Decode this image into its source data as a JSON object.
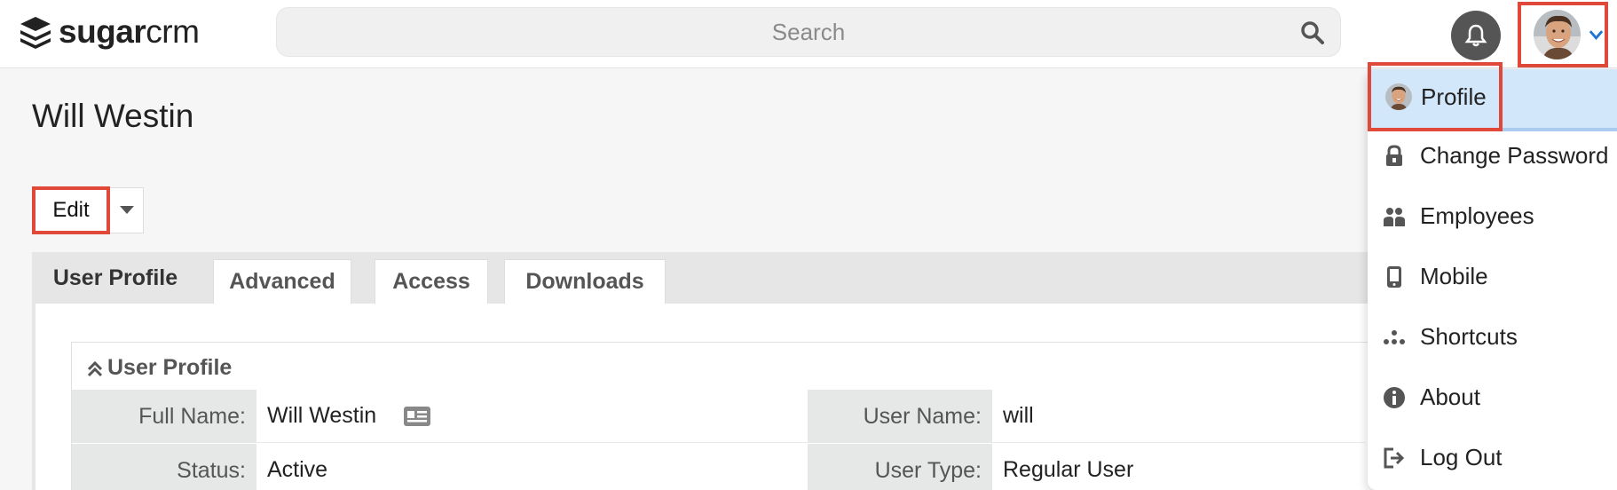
{
  "header": {
    "logo": {
      "bold": "sugar",
      "light": "crm"
    },
    "search": {
      "placeholder": "Search"
    },
    "icons": {
      "search": "search-icon",
      "notifications": "bell-icon",
      "user_menu": "chevron-down-icon"
    }
  },
  "record": {
    "title": "Will Westin",
    "edit_label": "Edit"
  },
  "tabs": [
    {
      "label": "User Profile",
      "active": true
    },
    {
      "label": "Advanced",
      "active": false
    },
    {
      "label": "Access",
      "active": false
    },
    {
      "label": "Downloads",
      "active": false
    }
  ],
  "section": {
    "title": "User Profile",
    "fields": [
      {
        "label": "Full Name:",
        "value": "Will Westin"
      },
      {
        "label": "User Name:",
        "value": "will"
      },
      {
        "label": "Status:",
        "value": "Active"
      },
      {
        "label": "User Type:",
        "value": "Regular User"
      }
    ]
  },
  "user_menu": {
    "items": [
      {
        "label": "Profile",
        "icon": "avatar-icon"
      },
      {
        "label": "Change Password",
        "icon": "lock-icon"
      },
      {
        "label": "Employees",
        "icon": "users-icon"
      },
      {
        "label": "Mobile",
        "icon": "mobile-icon"
      },
      {
        "label": "Shortcuts",
        "icon": "shortcuts-icon"
      },
      {
        "label": "About",
        "icon": "info-icon"
      },
      {
        "label": "Log Out",
        "icon": "logout-icon"
      }
    ]
  },
  "colors": {
    "highlight_box": "#e0493a",
    "menu_active": "#d3e7fb"
  }
}
